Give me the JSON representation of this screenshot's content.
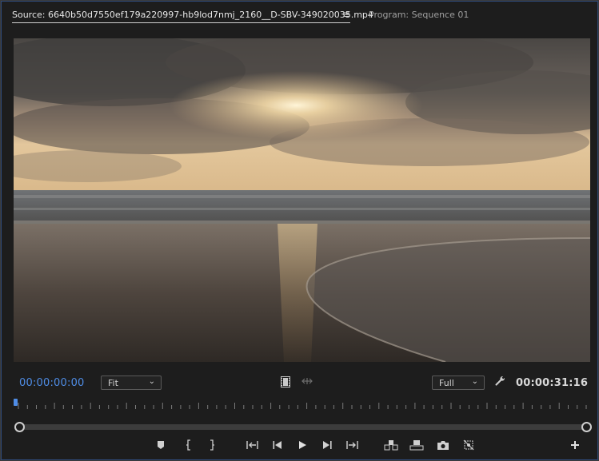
{
  "tabs": {
    "source_label": "Source: 6640b50d7550ef179a220997-hb9lod7nmj_2160__D-SBV-349020035.mp4",
    "menu_glyph": "≡",
    "program_label": "Program: Sequence 01"
  },
  "viewer": {
    "content": "sunset over ocean beach video frame"
  },
  "controls": {
    "current_timecode": "00:00:00:00",
    "zoom_value": "Fit",
    "resolution_value": "Full",
    "duration_timecode": "00:00:31:16",
    "chevron": "⌄"
  },
  "icons": {
    "menu": "hamburger-menu-icon",
    "film": "film-strip-icon",
    "compare": "compare-icon",
    "wrench": "wrench-icon"
  },
  "transport": [
    {
      "name": "add-marker-button",
      "icon": "marker-icon"
    },
    {
      "name": "mark-in-button",
      "icon": "mark-in-icon"
    },
    {
      "name": "mark-out-button",
      "icon": "mark-out-icon"
    },
    {
      "name": "go-to-in-button",
      "icon": "go-to-in-icon"
    },
    {
      "name": "step-back-button",
      "icon": "step-back-icon"
    },
    {
      "name": "play-button",
      "icon": "play-icon"
    },
    {
      "name": "step-forward-button",
      "icon": "step-forward-icon"
    },
    {
      "name": "go-to-out-button",
      "icon": "go-to-out-icon"
    },
    {
      "name": "insert-button",
      "icon": "insert-icon"
    },
    {
      "name": "overwrite-button",
      "icon": "overwrite-icon"
    },
    {
      "name": "export-frame-button",
      "icon": "camera-icon"
    },
    {
      "name": "insert-multicam-button",
      "icon": "multicam-icon"
    },
    {
      "name": "button-editor-button",
      "icon": "plus-icon"
    }
  ],
  "colors": {
    "timecode_blue": "#4f8de6",
    "panel_bg": "#1d1d1d",
    "accent_border": "#2e4a7a"
  }
}
